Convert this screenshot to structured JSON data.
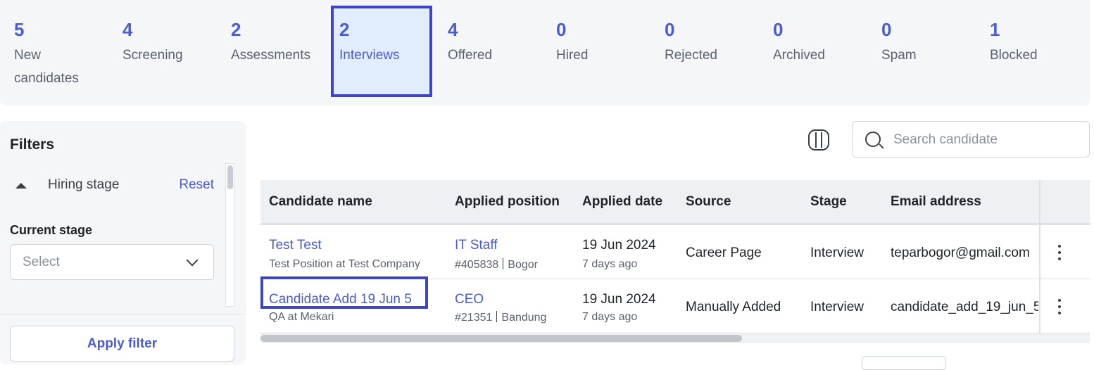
{
  "stages": [
    {
      "count": "5",
      "label": "New candidates"
    },
    {
      "count": "4",
      "label": "Screening"
    },
    {
      "count": "2",
      "label": "Assessments"
    },
    {
      "count": "2",
      "label": "Interviews"
    },
    {
      "count": "4",
      "label": "Offered"
    },
    {
      "count": "0",
      "label": "Hired"
    },
    {
      "count": "0",
      "label": "Rejected"
    },
    {
      "count": "0",
      "label": "Archived"
    },
    {
      "count": "0",
      "label": "Spam"
    },
    {
      "count": "1",
      "label": "Blocked"
    }
  ],
  "filters": {
    "title": "Filters",
    "hiring_stage_label": "Hiring stage",
    "reset_label": "Reset",
    "current_stage_label": "Current stage",
    "select_placeholder": "Select",
    "apply_label": "Apply filter"
  },
  "search": {
    "placeholder": "Search candidate"
  },
  "table": {
    "headers": [
      "Candidate name",
      "Applied position",
      "Applied date",
      "Source",
      "Stage",
      "Email address"
    ],
    "rows": [
      {
        "name": "Test Test",
        "company": "Test Position at Test Company",
        "position": "IT Staff",
        "position_id": "#405838",
        "location": "Bogor",
        "date": "19 Jun 2024",
        "ago": "7 days ago",
        "source": "Career Page",
        "stage": "Interview",
        "email": "teparbogor@gmail.com"
      },
      {
        "name": "Candidate Add 19 Jun 5",
        "company": "QA at Mekari",
        "position": "CEO",
        "position_id": "#21351",
        "location": "Bandung",
        "date": "19 Jun 2024",
        "ago": "7 days ago",
        "source": "Manually Added",
        "stage": "Interview",
        "email": "candidate_add_19_jun_5"
      }
    ]
  },
  "colors": {
    "accent": "#4a5cd0",
    "highlight": "#3d45c3",
    "active_bg": "#e1ecfc"
  },
  "icons": [
    "caret-up-icon",
    "chevron-down-icon",
    "columns-icon",
    "search-icon",
    "kebab-menu-icon"
  ]
}
